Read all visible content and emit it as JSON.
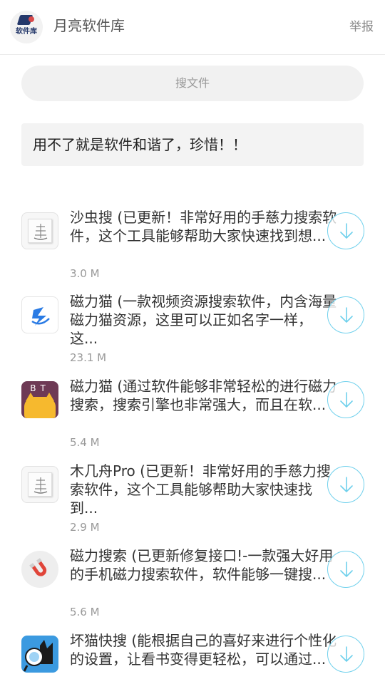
{
  "header": {
    "logo_text": "软件库",
    "app_name": "月亮软件库",
    "report_label": "举报"
  },
  "search": {
    "placeholder": "搜文件"
  },
  "notice": {
    "text": "用不了就是软件和谐了，珍惜！！"
  },
  "items": [
    {
      "icon": "ship-icon",
      "title": "沙虫搜 (已更新！非常好用的手慈力搜索软件，这个工具能够帮助大家快速找到想...",
      "size": "3.0 M"
    },
    {
      "icon": "magnet-cat-icon",
      "title": "磁力猫 (一款视频资源搜索软件，内含海量磁力猫资源，这里可以正如名字一样，这...",
      "size": "23.1 M"
    },
    {
      "icon": "bt-cat-icon",
      "icon_label": "BT",
      "title": "磁力猫 (通过软件能够非常轻松的进行磁力搜索，搜索引擎也非常强大，而且在软...",
      "size": "5.4 M"
    },
    {
      "icon": "ship-icon",
      "title": "木几舟Pro (已更新！非常好用的手慈力搜索软件，这个工具能够帮助大家快速找到...",
      "size": "2.9 M"
    },
    {
      "icon": "magnet-icon",
      "title": "磁力搜索 (已更新修复接口!-一款强大好用的手机磁力搜索软件，软件能够一键搜...",
      "size": "5.6 M"
    },
    {
      "icon": "bad-cat-icon",
      "title": "坏猫快搜 (能根据自己的喜好来进行个性化的设置，让看书变得更轻松，可以通过...",
      "size": ""
    }
  ],
  "colors": {
    "download_ring": "#6fd0ec",
    "bt_bg": "#6e3a55",
    "bt_cat": "#f6b92e",
    "magnet_red": "#e0453a"
  }
}
